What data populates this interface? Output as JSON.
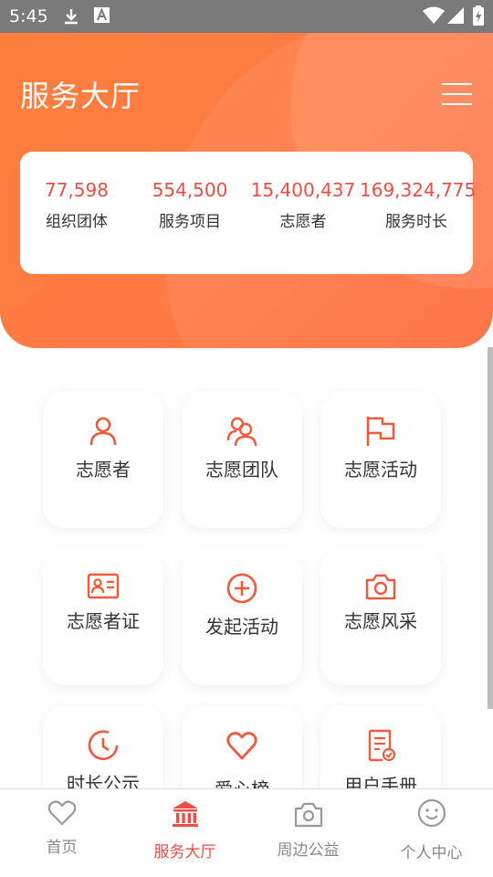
{
  "status_bar": {
    "time": "5:45"
  },
  "header": {
    "title": "服务大厅"
  },
  "stats": [
    {
      "value": "77,598",
      "label": "组织团体"
    },
    {
      "value": "554,500",
      "label": "服务项目"
    },
    {
      "value": "15,400,437",
      "label": "志愿者"
    },
    {
      "value": "169,324,775",
      "label": "服务时长"
    }
  ],
  "grid": [
    {
      "label": "志愿者",
      "icon": "user-icon"
    },
    {
      "label": "志愿团队",
      "icon": "team-icon"
    },
    {
      "label": "志愿活动",
      "icon": "flag-icon"
    },
    {
      "label": "志愿者证",
      "icon": "id-card-icon"
    },
    {
      "label": "发起活动",
      "icon": "plus-circle-icon"
    },
    {
      "label": "志愿风采",
      "icon": "camera-icon"
    },
    {
      "label": "时长公示",
      "icon": "clock-icon"
    },
    {
      "label": "爱心榜",
      "icon": "heart-icon"
    },
    {
      "label": "用户手册",
      "icon": "manual-icon"
    }
  ],
  "bottom_nav": [
    {
      "label": "首页",
      "icon": "heart-outline-icon",
      "active": false
    },
    {
      "label": "服务大厅",
      "icon": "hall-icon",
      "active": true
    },
    {
      "label": "周边公益",
      "icon": "camera-icon",
      "active": false
    },
    {
      "label": "个人中心",
      "icon": "smiley-icon",
      "active": false
    }
  ],
  "colors": {
    "accent": "#ee4d45",
    "header": "#ff7a45",
    "icon": "#ee5a3c"
  }
}
